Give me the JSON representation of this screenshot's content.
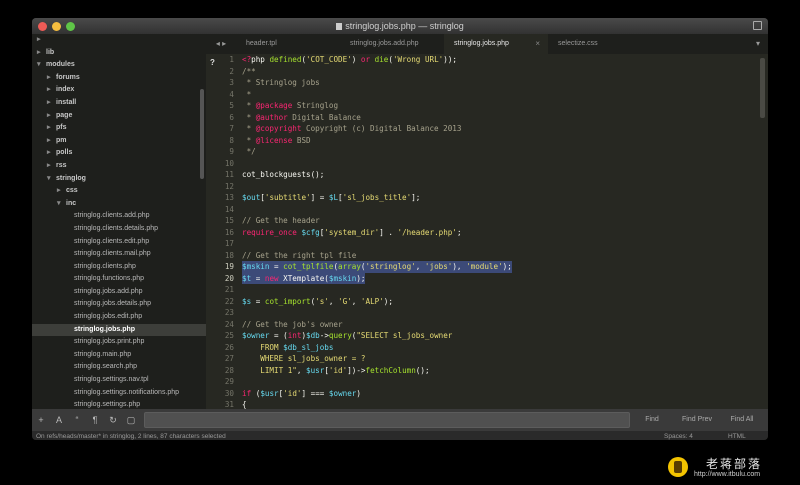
{
  "window": {
    "title": "stringlog.jobs.php — stringlog"
  },
  "sidebar": {
    "items": [
      {
        "label": "",
        "depth": 1,
        "folder": true,
        "arrow": "▸",
        "active": false
      },
      {
        "label": "lib",
        "depth": 1,
        "folder": true,
        "arrow": "▸",
        "active": false
      },
      {
        "label": "modules",
        "depth": 1,
        "folder": true,
        "arrow": "▾",
        "active": false
      },
      {
        "label": "forums",
        "depth": 2,
        "folder": true,
        "arrow": "▸",
        "active": false
      },
      {
        "label": "index",
        "depth": 2,
        "folder": true,
        "arrow": "▸",
        "active": false
      },
      {
        "label": "install",
        "depth": 2,
        "folder": true,
        "arrow": "▸",
        "active": false
      },
      {
        "label": "page",
        "depth": 2,
        "folder": true,
        "arrow": "▸",
        "active": false
      },
      {
        "label": "pfs",
        "depth": 2,
        "folder": true,
        "arrow": "▸",
        "active": false
      },
      {
        "label": "pm",
        "depth": 2,
        "folder": true,
        "arrow": "▸",
        "active": false
      },
      {
        "label": "polls",
        "depth": 2,
        "folder": true,
        "arrow": "▸",
        "active": false
      },
      {
        "label": "rss",
        "depth": 2,
        "folder": true,
        "arrow": "▸",
        "active": false
      },
      {
        "label": "stringlog",
        "depth": 2,
        "folder": true,
        "arrow": "▾",
        "active": false
      },
      {
        "label": "css",
        "depth": 3,
        "folder": true,
        "arrow": "▸",
        "active": false
      },
      {
        "label": "inc",
        "depth": 3,
        "folder": true,
        "arrow": "▾",
        "active": false
      },
      {
        "label": "stringlog.clients.add.php",
        "depth": 4,
        "folder": false,
        "arrow": "",
        "active": false
      },
      {
        "label": "stringlog.clients.details.php",
        "depth": 4,
        "folder": false,
        "arrow": "",
        "active": false
      },
      {
        "label": "stringlog.clients.edit.php",
        "depth": 4,
        "folder": false,
        "arrow": "",
        "active": false
      },
      {
        "label": "stringlog.clients.mail.php",
        "depth": 4,
        "folder": false,
        "arrow": "",
        "active": false
      },
      {
        "label": "stringlog.clients.php",
        "depth": 4,
        "folder": false,
        "arrow": "",
        "active": false
      },
      {
        "label": "stringlog.functions.php",
        "depth": 4,
        "folder": false,
        "arrow": "",
        "active": false
      },
      {
        "label": "stringlog.jobs.add.php",
        "depth": 4,
        "folder": false,
        "arrow": "",
        "active": false
      },
      {
        "label": "stringlog.jobs.details.php",
        "depth": 4,
        "folder": false,
        "arrow": "",
        "active": false
      },
      {
        "label": "stringlog.jobs.edit.php",
        "depth": 4,
        "folder": false,
        "arrow": "",
        "active": false
      },
      {
        "label": "stringlog.jobs.php",
        "depth": 4,
        "folder": false,
        "arrow": "",
        "active": true
      },
      {
        "label": "stringlog.jobs.print.php",
        "depth": 4,
        "folder": false,
        "arrow": "",
        "active": false
      },
      {
        "label": "stringlog.main.php",
        "depth": 4,
        "folder": false,
        "arrow": "",
        "active": false
      },
      {
        "label": "stringlog.search.php",
        "depth": 4,
        "folder": false,
        "arrow": "",
        "active": false
      },
      {
        "label": "stringlog.settings.nav.tpl",
        "depth": 4,
        "folder": false,
        "arrow": "",
        "active": false
      },
      {
        "label": "stringlog.settings.notifications.php",
        "depth": 4,
        "folder": false,
        "arrow": "",
        "active": false
      },
      {
        "label": "stringlog.settings.php",
        "depth": 4,
        "folder": false,
        "arrow": "",
        "active": false
      }
    ]
  },
  "tabs": {
    "nav": "◂ ▸",
    "items": [
      {
        "label": "header.tpl",
        "active": false
      },
      {
        "label": "stringlog.jobs.add.php",
        "active": false
      },
      {
        "label": "stringlog.jobs.php",
        "active": true
      },
      {
        "label": "selectize.css",
        "active": false
      }
    ],
    "close_glyph": "×",
    "menu_glyph": "▾"
  },
  "editor": {
    "gutter_mark": "?",
    "lines": [
      {
        "n": "1",
        "hl": false,
        "sel": false,
        "tokens": [
          [
            "tag",
            "<?"
          ],
          [
            "txt",
            "php "
          ],
          [
            "fn",
            "defined"
          ],
          [
            "txt",
            "("
          ],
          [
            "str",
            "'COT_CODE'"
          ],
          [
            "txt",
            ") "
          ],
          [
            "kw",
            "or"
          ],
          [
            "txt",
            " "
          ],
          [
            "fn",
            "die"
          ],
          [
            "txt",
            "("
          ],
          [
            "str",
            "'Wrong URL'"
          ],
          [
            "txt",
            "));"
          ]
        ]
      },
      {
        "n": "2",
        "hl": false,
        "sel": false,
        "tokens": [
          [
            "cmt",
            "/**"
          ]
        ]
      },
      {
        "n": "3",
        "hl": false,
        "sel": false,
        "tokens": [
          [
            "cmt",
            " * Stringlog jobs"
          ]
        ]
      },
      {
        "n": "4",
        "hl": false,
        "sel": false,
        "tokens": [
          [
            "cmt",
            " *"
          ]
        ]
      },
      {
        "n": "5",
        "hl": false,
        "sel": false,
        "tokens": [
          [
            "cmt",
            " * "
          ],
          [
            "kw",
            "@package"
          ],
          [
            "cmt",
            " Stringlog"
          ]
        ]
      },
      {
        "n": "6",
        "hl": false,
        "sel": false,
        "tokens": [
          [
            "cmt",
            " * "
          ],
          [
            "kw",
            "@author"
          ],
          [
            "cmt",
            " Digital Balance"
          ]
        ]
      },
      {
        "n": "7",
        "hl": false,
        "sel": false,
        "tokens": [
          [
            "cmt",
            " * "
          ],
          [
            "kw",
            "@copyright"
          ],
          [
            "cmt",
            " Copyright (c) Digital Balance 2013"
          ]
        ]
      },
      {
        "n": "8",
        "hl": false,
        "sel": false,
        "tokens": [
          [
            "cmt",
            " * "
          ],
          [
            "kw",
            "@license"
          ],
          [
            "cmt",
            " BSD"
          ]
        ]
      },
      {
        "n": "9",
        "hl": false,
        "sel": false,
        "tokens": [
          [
            "cmt",
            " */"
          ]
        ]
      },
      {
        "n": "10",
        "hl": false,
        "sel": false,
        "tokens": []
      },
      {
        "n": "11",
        "hl": false,
        "sel": false,
        "tokens": [
          [
            "txt",
            "cot_blockguests();"
          ]
        ]
      },
      {
        "n": "12",
        "hl": false,
        "sel": false,
        "tokens": []
      },
      {
        "n": "13",
        "hl": false,
        "sel": false,
        "tokens": [
          [
            "var",
            "$out"
          ],
          [
            "txt",
            "["
          ],
          [
            "str",
            "'subtitle'"
          ],
          [
            "txt",
            "] = "
          ],
          [
            "var",
            "$L"
          ],
          [
            "txt",
            "["
          ],
          [
            "str",
            "'sl_jobs_title'"
          ],
          [
            "txt",
            "];"
          ]
        ]
      },
      {
        "n": "14",
        "hl": false,
        "sel": false,
        "tokens": []
      },
      {
        "n": "15",
        "hl": false,
        "sel": false,
        "tokens": [
          [
            "cmt",
            "// Get the header"
          ]
        ]
      },
      {
        "n": "16",
        "hl": false,
        "sel": false,
        "tokens": [
          [
            "kw",
            "require_once"
          ],
          [
            "txt",
            " "
          ],
          [
            "var",
            "$cfg"
          ],
          [
            "txt",
            "["
          ],
          [
            "str",
            "'system_dir'"
          ],
          [
            "txt",
            "] . "
          ],
          [
            "str",
            "'/header.php'"
          ],
          [
            "txt",
            ";"
          ]
        ]
      },
      {
        "n": "17",
        "hl": false,
        "sel": false,
        "tokens": []
      },
      {
        "n": "18",
        "hl": false,
        "sel": false,
        "tokens": [
          [
            "cmt",
            "// Get the right tpl file"
          ]
        ]
      },
      {
        "n": "19",
        "hl": true,
        "sel": true,
        "tokens": [
          [
            "var",
            "$mskin"
          ],
          [
            "txt",
            " = "
          ],
          [
            "fn",
            "cot_tplfile"
          ],
          [
            "txt",
            "("
          ],
          [
            "fn",
            "array"
          ],
          [
            "txt",
            "("
          ],
          [
            "str",
            "'stringlog'"
          ],
          [
            "txt",
            ", "
          ],
          [
            "str",
            "'jobs'"
          ],
          [
            "txt",
            "), "
          ],
          [
            "str",
            "'module'"
          ],
          [
            "txt",
            ");"
          ]
        ]
      },
      {
        "n": "20",
        "hl": true,
        "sel": true,
        "tokens": [
          [
            "var",
            "$t"
          ],
          [
            "txt",
            " = "
          ],
          [
            "kw",
            "new"
          ],
          [
            "txt",
            " XTemplate("
          ],
          [
            "var",
            "$mskin"
          ],
          [
            "txt",
            ");"
          ]
        ]
      },
      {
        "n": "21",
        "hl": false,
        "sel": false,
        "tokens": []
      },
      {
        "n": "22",
        "hl": false,
        "sel": false,
        "tokens": [
          [
            "var",
            "$s"
          ],
          [
            "txt",
            " = "
          ],
          [
            "fn",
            "cot_import"
          ],
          [
            "txt",
            "("
          ],
          [
            "str",
            "'s'"
          ],
          [
            "txt",
            ", "
          ],
          [
            "str",
            "'G'"
          ],
          [
            "txt",
            ", "
          ],
          [
            "str",
            "'ALP'"
          ],
          [
            "txt",
            ");"
          ]
        ]
      },
      {
        "n": "23",
        "hl": false,
        "sel": false,
        "tokens": []
      },
      {
        "n": "24",
        "hl": false,
        "sel": false,
        "tokens": [
          [
            "cmt",
            "// Get the job's owner"
          ]
        ]
      },
      {
        "n": "25",
        "hl": false,
        "sel": false,
        "tokens": [
          [
            "var",
            "$owner"
          ],
          [
            "txt",
            " = ("
          ],
          [
            "kw",
            "int"
          ],
          [
            "txt",
            ")"
          ],
          [
            "var",
            "$db"
          ],
          [
            "txt",
            "->"
          ],
          [
            "fn",
            "query"
          ],
          [
            "txt",
            "("
          ],
          [
            "str",
            "\"SELECT sl_jobs_owner"
          ]
        ]
      },
      {
        "n": "26",
        "hl": false,
        "sel": false,
        "tokens": [
          [
            "str",
            "    FROM "
          ],
          [
            "var",
            "$db_sl_jobs"
          ]
        ]
      },
      {
        "n": "27",
        "hl": false,
        "sel": false,
        "tokens": [
          [
            "str",
            "    WHERE sl_jobs_owner = ?"
          ]
        ]
      },
      {
        "n": "28",
        "hl": false,
        "sel": false,
        "tokens": [
          [
            "str",
            "    LIMIT 1\""
          ],
          [
            "txt",
            ", "
          ],
          [
            "var",
            "$usr"
          ],
          [
            "txt",
            "["
          ],
          [
            "str",
            "'id'"
          ],
          [
            "txt",
            "])->"
          ],
          [
            "fn",
            "fetchColumn"
          ],
          [
            "txt",
            "();"
          ]
        ]
      },
      {
        "n": "29",
        "hl": false,
        "sel": false,
        "tokens": []
      },
      {
        "n": "30",
        "hl": false,
        "sel": false,
        "tokens": [
          [
            "kw",
            "if"
          ],
          [
            "txt",
            " ("
          ],
          [
            "var",
            "$usr"
          ],
          [
            "txt",
            "["
          ],
          [
            "str",
            "'id'"
          ],
          [
            "txt",
            "] === "
          ],
          [
            "var",
            "$owner"
          ],
          [
            "txt",
            ")"
          ]
        ]
      },
      {
        "n": "31",
        "hl": false,
        "sel": false,
        "tokens": [
          [
            "txt",
            "{"
          ]
        ]
      }
    ]
  },
  "findbar": {
    "icons": [
      "plus-icon",
      "font-icon",
      "regex-icon",
      "case-icon",
      "wrap-icon",
      "selection-icon"
    ],
    "icon_glyphs": [
      "+",
      "A",
      "“",
      "¶",
      "↻",
      "▢"
    ],
    "search_value": "",
    "find_label": "Find",
    "find_prev_label": "Find Prev",
    "find_all_label": "Find All"
  },
  "statusbar": {
    "left": "On refs/heads/master* in stringlog, 2 lines, 87 characters selected",
    "spaces": "Spaces: 4",
    "syntax": "HTML"
  },
  "watermark": {
    "cn": "老蒋部落",
    "url": "http://www.itbulu.com"
  }
}
